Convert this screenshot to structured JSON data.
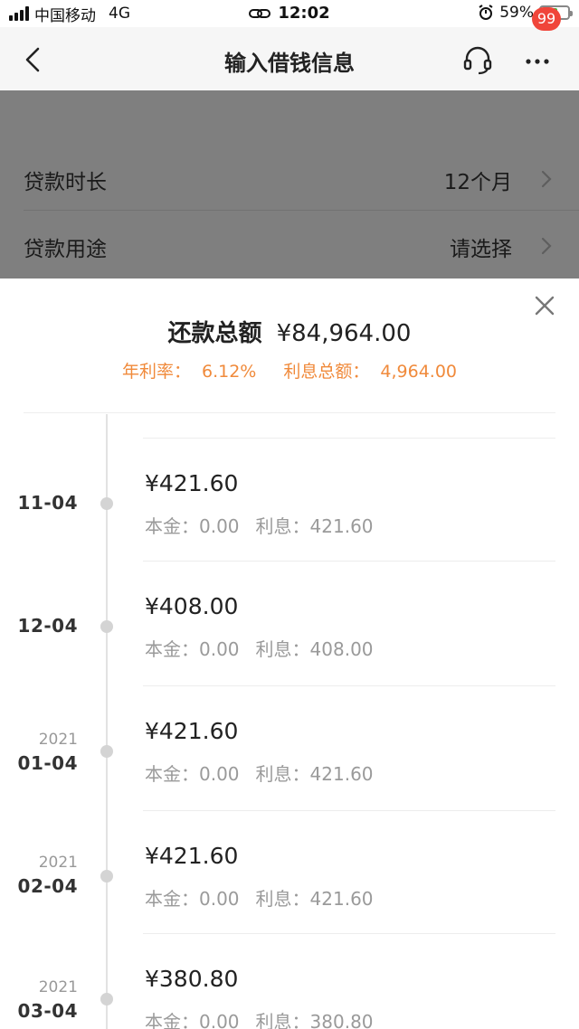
{
  "status_bar": {
    "carrier": "中国移动",
    "network": "4G",
    "time": "12:02",
    "battery": "59%",
    "battery_level": 0.59
  },
  "nav": {
    "title": "输入借钱信息",
    "badge": "99"
  },
  "loan_rows": [
    {
      "label": "贷款时长",
      "value": "12个月"
    },
    {
      "label": "贷款用途",
      "value": "请选择"
    }
  ],
  "sheet": {
    "title_label": "还款总额",
    "title_value": "¥84,964.00",
    "rate_label": "年利率：",
    "rate_value": "6.12%",
    "interest_total_label": "利息总额：",
    "interest_total_value": "4,964.00"
  },
  "schedule": [
    {
      "year": "",
      "date": "11-04",
      "amount": "¥421.60",
      "principal_label": "本金：",
      "principal": "0.00",
      "interest_label": "利息：",
      "interest": "421.60"
    },
    {
      "year": "",
      "date": "12-04",
      "amount": "¥408.00",
      "principal_label": "本金：",
      "principal": "0.00",
      "interest_label": "利息：",
      "interest": "408.00"
    },
    {
      "year": "2021",
      "date": "01-04",
      "amount": "¥421.60",
      "principal_label": "本金：",
      "principal": "0.00",
      "interest_label": "利息：",
      "interest": "421.60"
    },
    {
      "year": "2021",
      "date": "02-04",
      "amount": "¥421.60",
      "principal_label": "本金：",
      "principal": "0.00",
      "interest_label": "利息：",
      "interest": "421.60"
    },
    {
      "year": "2021",
      "date": "03-04",
      "amount": "¥380.80",
      "principal_label": "本金：",
      "principal": "0.00",
      "interest_label": "利息：",
      "interest": "380.80"
    }
  ],
  "colors": {
    "accent_orange": "#f08a3b",
    "badge_red": "#f0453a",
    "overlay_gray": "#7f7f7f"
  }
}
